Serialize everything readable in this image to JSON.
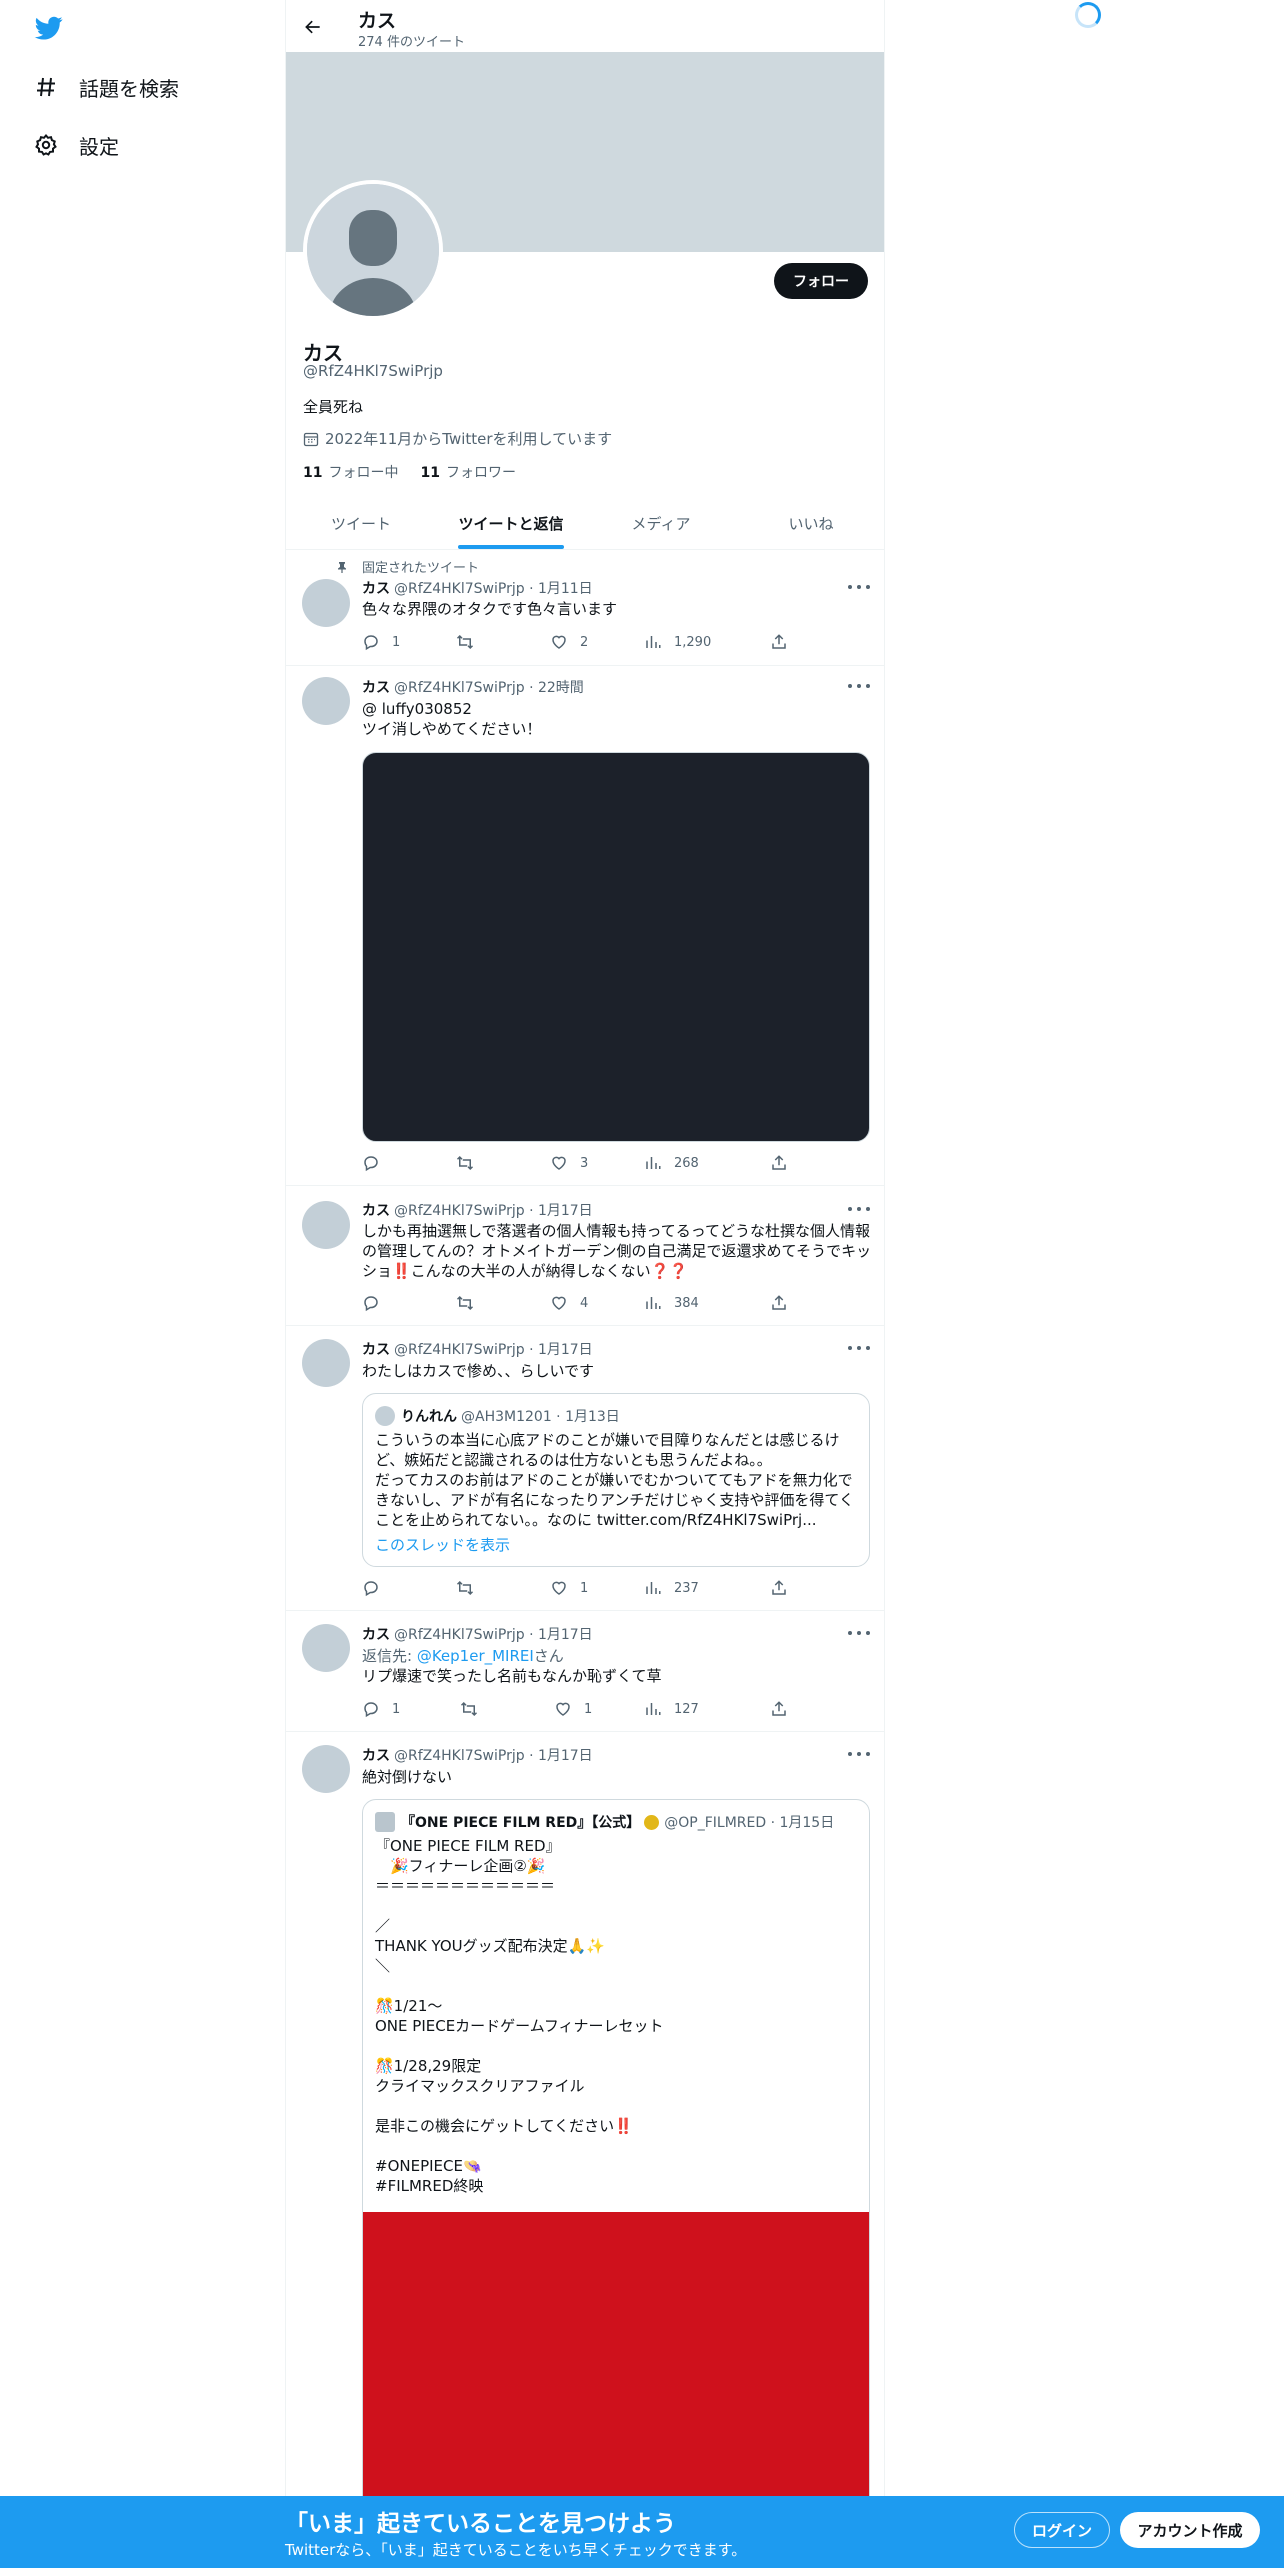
{
  "nav": {
    "explore_label": "話題を検索",
    "settings_label": "設定"
  },
  "header": {
    "name": "カス",
    "tweet_count": "274 件のツイート"
  },
  "profile": {
    "follow_label": "フォロー",
    "name": "カス",
    "handle": "@RfZ4HKl7SwiPrjp",
    "bio": "全員死ね",
    "joined": "2022年11月からTwitterを利用しています",
    "following_count": "11",
    "following_label": "フォロー中",
    "followers_count": "11",
    "followers_label": "フォロワー"
  },
  "tabs": [
    {
      "label": "ツイート"
    },
    {
      "label": "ツイートと返信"
    },
    {
      "label": "メディア"
    },
    {
      "label": "いいね"
    }
  ],
  "tweets": [
    {
      "pinned_label": "固定されたツイート",
      "name": "カス",
      "meta": "@RfZ4HKl7SwiPrjp · 1月11日",
      "text": "色々な界隈のオタクです色々言います",
      "replies": "1",
      "retweets": "",
      "likes": "2",
      "views": "1,290"
    },
    {
      "name": "カス",
      "meta": "@RfZ4HKl7SwiPrjp · 22時間",
      "text": "@ luffy030852\nツイ消しやめてください！",
      "replies": "",
      "retweets": "",
      "likes": "3",
      "views": "268"
    },
    {
      "name": "カス",
      "meta": "@RfZ4HKl7SwiPrjp · 1月17日",
      "text": "しかも再抽選無しで落選者の個人情報も持ってるってどうな杜撰な個人情報の管理してんの？オトメイトガーデン側の自己満足で返還求めてそうでキッショ‼️こんなの大半の人が納得しなくない❓❓",
      "replies": "",
      "retweets": "",
      "likes": "4",
      "views": "384"
    },
    {
      "name": "カス",
      "meta": "@RfZ4HKl7SwiPrjp · 1月17日",
      "text": "わたしはカスで惨め、、らしいです",
      "quote": {
        "name": "りんれん",
        "meta": "@AH3M1201 · 1月13日",
        "text": "こういうの本当に心底アドのことが嫌いで目障りなんだとは感じるけど、嫉妬だと認識されるのは仕方ないとも思うんだよね。。\nだってカスのお前はアドのことが嫌いでむかついててもアドを無力化できないし、アドが有名になったりアンチだけじゃく支持や評価を得てくことを止められてない。。なのに twitter.com/RfZ4HKl7SwiPrj...",
        "thread_link": "このスレッドを表示"
      },
      "replies": "",
      "retweets": "",
      "likes": "1",
      "views": "237"
    },
    {
      "name": "カス",
      "meta": "@RfZ4HKl7SwiPrjp · 1月17日",
      "reply_prefix": "返信先: ",
      "reply_to": "@Kep1er_MIREI",
      "reply_suffix": "さん",
      "text": "リプ爆速で笑ったし名前もなんか恥ずくて草",
      "replies": "1",
      "retweets": "",
      "likes": "1",
      "views": "127"
    },
    {
      "name": "カス",
      "meta": "@RfZ4HKl7SwiPrjp · 1月17日",
      "text": "絶対倒けない",
      "quote": {
        "name": "『ONE PIECE FILM RED』【公式】",
        "meta": "@OP_FILMRED · 1月15日",
        "text": "『ONE PIECE FILM RED』\n　🎉フィナーレ企画②🎉\n＝＝＝＝＝＝＝＝＝＝＝＝\n\n／\nTHANK YOUグッズ配布決定🙏✨\n＼\n\n🎊1/21〜\nONE PIECEカードゲームフィナーレセット\n\n🎊1/28,29限定\nクライマックスクリアファイル\n\n是非この機会にゲットしてください‼️\n\n#ONEPIECE👒\n#FILMRED終映"
      },
      "replies": "",
      "retweets": "",
      "likes": "",
      "views": ""
    }
  ],
  "bottom_bar": {
    "title": "「いま」起きていることを見つけよう",
    "subtitle": "Twitterなら、「いま」起きていることをいち早くチェックできます。",
    "login_label": "ログイン",
    "signup_label": "アカウント作成"
  },
  "colors": {
    "brand": "#1d9bf0",
    "text": "#0f1419",
    "muted": "#536471",
    "banner": "#cfd9de",
    "dark_media": "#1c212a",
    "red_media": "#cf111c"
  },
  "icons": [
    "twitter-logo-icon",
    "hashtag-icon",
    "gear-icon",
    "back-arrow-icon",
    "calendar-icon",
    "pin-icon",
    "reply-icon",
    "retweet-icon",
    "like-icon",
    "views-icon",
    "share-icon",
    "more-icon",
    "loading-spinner-icon"
  ]
}
